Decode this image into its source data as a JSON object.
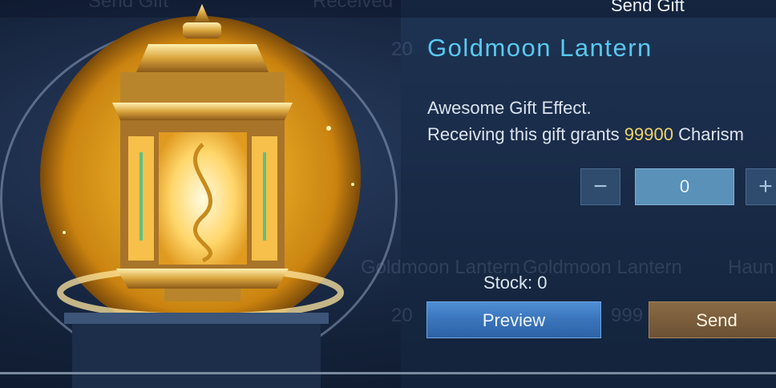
{
  "background_labels": [
    "Send Gift",
    "Received",
    "Goldmoon Lantern",
    "Haun",
    "20",
    "999"
  ],
  "header": {
    "send_gift_label": "Send Gift"
  },
  "gift": {
    "name": "Goldmoon Lantern",
    "effect_text": "Awesome Gift Effect.",
    "grant_prefix": "Receiving this gift grants ",
    "grant_value": "99900",
    "grant_suffix": " Charism"
  },
  "quantity": {
    "minus_label": "−",
    "value": "0",
    "plus_label": "+"
  },
  "stock_text": "Stock: 0",
  "buttons": {
    "preview": "Preview",
    "send": "Send"
  },
  "colors": {
    "title": "#59c9f0",
    "highlight": "#f0d36a",
    "preview_bg": "#3a74bb",
    "send_bg": "#6c5134"
  }
}
